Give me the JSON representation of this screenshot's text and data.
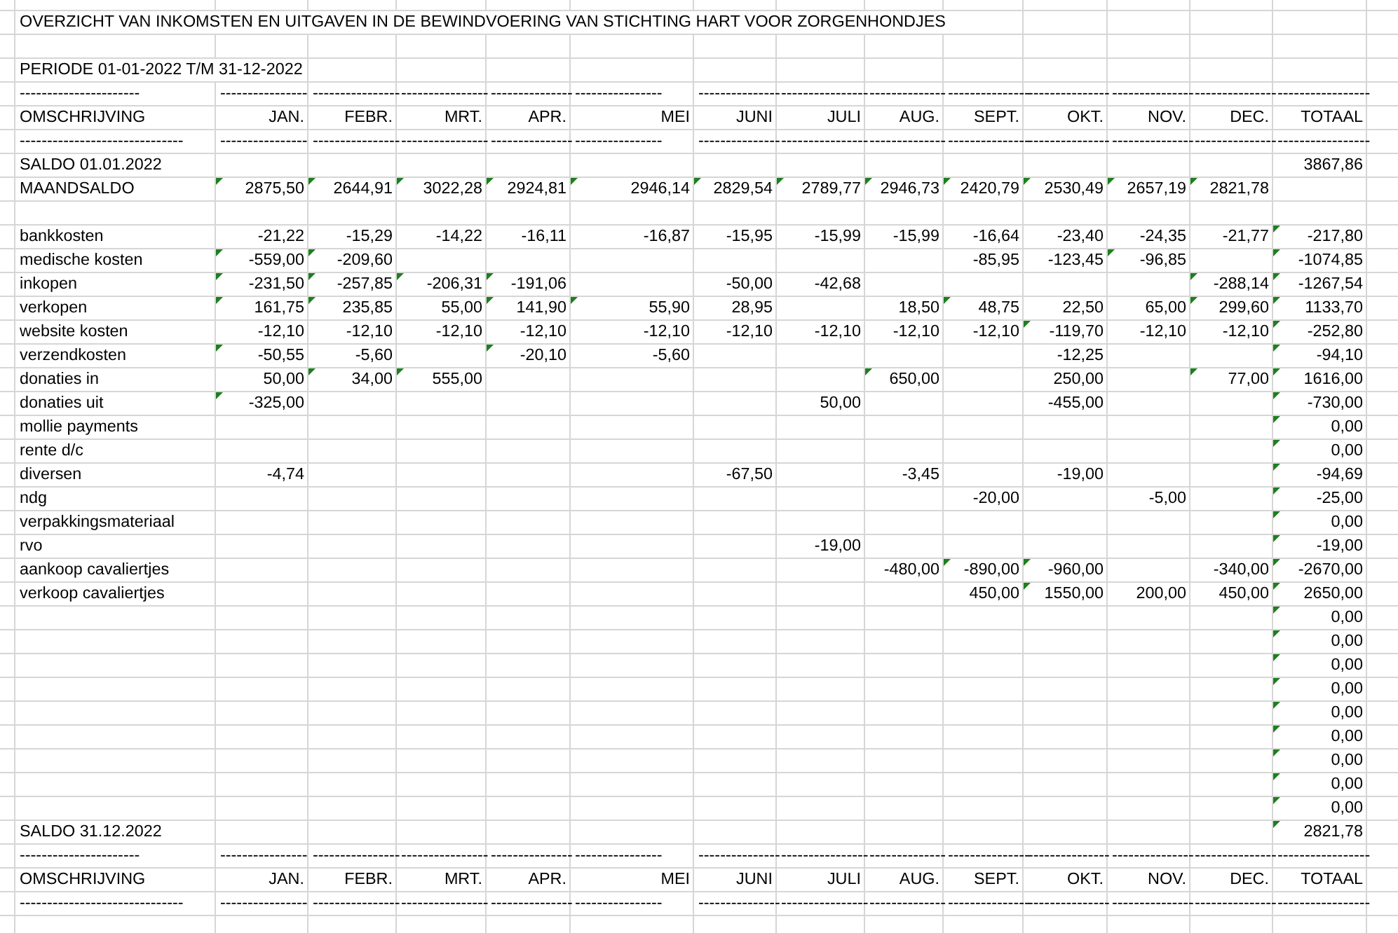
{
  "sheet": {
    "rows": [
      {
        "kind": "title",
        "label": "OVERZICHT VAN INKOMSTEN EN UITGAVEN IN DE BEWINDVOERING VAN STICHTING HART VOOR ZORGENHONDJES"
      },
      {
        "kind": "blank"
      },
      {
        "kind": "period",
        "label": "PERIODE 01-01-2022 T/M 31-12-2022"
      },
      {
        "kind": "rule",
        "label": "----------------------",
        "cells": [
          "----------------",
          "----------------",
          "----------------",
          "---------------",
          "----------------",
          "---------------",
          "----------------",
          "--------------",
          "---------------",
          "---------------",
          "---------------",
          "---------------",
          "-----------------"
        ]
      },
      {
        "kind": "header",
        "label": "OMSCHRIJVING",
        "cells": [
          "JAN.",
          "FEBR.",
          "MRT.",
          "APR.",
          "MEI",
          "JUNI",
          "JULI",
          "AUG.",
          "SEPT.",
          "OKT.",
          "NOV.",
          "DEC.",
          "TOTAAL"
        ]
      },
      {
        "kind": "rule",
        "label": "------------------------------",
        "cells": [
          "----------------",
          "----------------",
          "----------------",
          "---------------",
          "----------------",
          "---------------",
          "----------------",
          "--------------",
          "---------------",
          "---------------",
          "---------------",
          "---------------",
          "-----------------"
        ]
      },
      {
        "kind": "data",
        "label": "SALDO 01.01.2022",
        "cells": [
          null,
          null,
          null,
          null,
          null,
          null,
          null,
          null,
          null,
          null,
          null,
          null,
          {
            "value": "3867,86",
            "flagged": false
          }
        ]
      },
      {
        "kind": "data",
        "label": "MAANDSALDO",
        "cells": [
          {
            "value": "2875,50",
            "flagged": true
          },
          {
            "value": "2644,91",
            "flagged": true
          },
          {
            "value": "3022,28",
            "flagged": true
          },
          {
            "value": "2924,81",
            "flagged": true
          },
          {
            "value": "2946,14",
            "flagged": true
          },
          {
            "value": "2829,54",
            "flagged": true
          },
          {
            "value": "2789,77",
            "flagged": true
          },
          {
            "value": "2946,73",
            "flagged": true
          },
          {
            "value": "2420,79",
            "flagged": true
          },
          {
            "value": "2530,49",
            "flagged": true
          },
          {
            "value": "2657,19",
            "flagged": true
          },
          {
            "value": "2821,78",
            "flagged": true
          },
          null
        ]
      },
      {
        "kind": "blank"
      },
      {
        "kind": "data",
        "label": "bankkosten",
        "cells": [
          {
            "value": "-21,22",
            "flagged": false
          },
          {
            "value": "-15,29",
            "flagged": false
          },
          {
            "value": "-14,22",
            "flagged": false
          },
          {
            "value": "-16,11",
            "flagged": false
          },
          {
            "value": "-16,87",
            "flagged": false
          },
          {
            "value": "-15,95",
            "flagged": false
          },
          {
            "value": "-15,99",
            "flagged": false
          },
          {
            "value": "-15,99",
            "flagged": false
          },
          {
            "value": "-16,64",
            "flagged": false
          },
          {
            "value": "-23,40",
            "flagged": false
          },
          {
            "value": "-24,35",
            "flagged": false
          },
          {
            "value": "-21,77",
            "flagged": false
          },
          {
            "value": "-217,80",
            "flagged": true
          }
        ]
      },
      {
        "kind": "data",
        "label": "medische kosten",
        "cells": [
          {
            "value": "-559,00",
            "flagged": true
          },
          {
            "value": "-209,60",
            "flagged": true
          },
          null,
          null,
          null,
          null,
          null,
          null,
          {
            "value": "-85,95",
            "flagged": false
          },
          {
            "value": "-123,45",
            "flagged": false
          },
          {
            "value": "-96,85",
            "flagged": true
          },
          null,
          {
            "value": "-1074,85",
            "flagged": true
          }
        ]
      },
      {
        "kind": "data",
        "label": "inkopen",
        "cells": [
          {
            "value": "-231,50",
            "flagged": true
          },
          {
            "value": "-257,85",
            "flagged": true
          },
          {
            "value": "-206,31",
            "flagged": true
          },
          {
            "value": "-191,06",
            "flagged": true
          },
          null,
          {
            "value": "-50,00",
            "flagged": false
          },
          {
            "value": "-42,68",
            "flagged": false
          },
          null,
          null,
          null,
          null,
          {
            "value": "-288,14",
            "flagged": true
          },
          {
            "value": "-1267,54",
            "flagged": true
          }
        ]
      },
      {
        "kind": "data",
        "label": "verkopen",
        "cells": [
          {
            "value": "161,75",
            "flagged": true
          },
          {
            "value": "235,85",
            "flagged": true
          },
          {
            "value": "55,00",
            "flagged": false
          },
          {
            "value": "141,90",
            "flagged": true
          },
          {
            "value": "55,90",
            "flagged": true
          },
          {
            "value": "28,95",
            "flagged": false
          },
          null,
          {
            "value": "18,50",
            "flagged": false
          },
          {
            "value": "48,75",
            "flagged": true
          },
          {
            "value": "22,50",
            "flagged": false
          },
          {
            "value": "65,00",
            "flagged": false
          },
          {
            "value": "299,60",
            "flagged": true
          },
          {
            "value": "1133,70",
            "flagged": true
          }
        ]
      },
      {
        "kind": "data",
        "label": "website kosten",
        "cells": [
          {
            "value": "-12,10",
            "flagged": false
          },
          {
            "value": "-12,10",
            "flagged": false
          },
          {
            "value": "-12,10",
            "flagged": false
          },
          {
            "value": "-12,10",
            "flagged": false
          },
          {
            "value": "-12,10",
            "flagged": false
          },
          {
            "value": "-12,10",
            "flagged": false
          },
          {
            "value": "-12,10",
            "flagged": false
          },
          {
            "value": "-12,10",
            "flagged": false
          },
          {
            "value": "-12,10",
            "flagged": false
          },
          {
            "value": "-119,70",
            "flagged": true
          },
          {
            "value": "-12,10",
            "flagged": false
          },
          {
            "value": "-12,10",
            "flagged": false
          },
          {
            "value": "-252,80",
            "flagged": true
          }
        ]
      },
      {
        "kind": "data",
        "label": "verzendkosten",
        "cells": [
          {
            "value": "-50,55",
            "flagged": true
          },
          {
            "value": "-5,60",
            "flagged": false
          },
          null,
          {
            "value": "-20,10",
            "flagged": true
          },
          {
            "value": "-5,60",
            "flagged": false
          },
          null,
          null,
          null,
          null,
          {
            "value": "-12,25",
            "flagged": false
          },
          null,
          null,
          {
            "value": "-94,10",
            "flagged": true
          }
        ]
      },
      {
        "kind": "data",
        "label": "donaties in",
        "cells": [
          {
            "value": "50,00",
            "flagged": false
          },
          {
            "value": "34,00",
            "flagged": true
          },
          {
            "value": "555,00",
            "flagged": true
          },
          null,
          null,
          null,
          null,
          {
            "value": "650,00",
            "flagged": true
          },
          null,
          {
            "value": "250,00",
            "flagged": false
          },
          null,
          {
            "value": "77,00",
            "flagged": true
          },
          {
            "value": "1616,00",
            "flagged": true
          }
        ]
      },
      {
        "kind": "data",
        "label": "donaties uit",
        "cells": [
          {
            "value": "-325,00",
            "flagged": true
          },
          null,
          null,
          null,
          null,
          null,
          {
            "value": "50,00",
            "flagged": false
          },
          null,
          null,
          {
            "value": "-455,00",
            "flagged": false
          },
          null,
          null,
          {
            "value": "-730,00",
            "flagged": true
          }
        ]
      },
      {
        "kind": "data",
        "label": "mollie payments",
        "cells": [
          null,
          null,
          null,
          null,
          null,
          null,
          null,
          null,
          null,
          null,
          null,
          null,
          {
            "value": "0,00",
            "flagged": true
          }
        ]
      },
      {
        "kind": "data",
        "label": "rente d/c",
        "cells": [
          null,
          null,
          null,
          null,
          null,
          null,
          null,
          null,
          null,
          null,
          null,
          null,
          {
            "value": "0,00",
            "flagged": true
          }
        ]
      },
      {
        "kind": "data",
        "label": "diversen",
        "cells": [
          {
            "value": "-4,74",
            "flagged": false
          },
          null,
          null,
          null,
          null,
          {
            "value": "-67,50",
            "flagged": false
          },
          null,
          {
            "value": "-3,45",
            "flagged": false
          },
          null,
          {
            "value": "-19,00",
            "flagged": false
          },
          null,
          null,
          {
            "value": "-94,69",
            "flagged": true
          }
        ]
      },
      {
        "kind": "data",
        "label": "ndg",
        "cells": [
          null,
          null,
          null,
          null,
          null,
          null,
          null,
          null,
          {
            "value": "-20,00",
            "flagged": false
          },
          null,
          {
            "value": "-5,00",
            "flagged": false
          },
          null,
          {
            "value": "-25,00",
            "flagged": true
          }
        ]
      },
      {
        "kind": "data",
        "label": "verpakkingsmateriaal",
        "cells": [
          null,
          null,
          null,
          null,
          null,
          null,
          null,
          null,
          null,
          null,
          null,
          null,
          {
            "value": "0,00",
            "flagged": true
          }
        ]
      },
      {
        "kind": "data",
        "label": "rvo",
        "cells": [
          null,
          null,
          null,
          null,
          null,
          null,
          {
            "value": "-19,00",
            "flagged": false
          },
          null,
          null,
          null,
          null,
          null,
          {
            "value": "-19,00",
            "flagged": true
          }
        ]
      },
      {
        "kind": "data",
        "label": "aankoop cavaliertjes",
        "cells": [
          null,
          null,
          null,
          null,
          null,
          null,
          null,
          {
            "value": "-480,00",
            "flagged": false
          },
          {
            "value": "-890,00",
            "flagged": true
          },
          {
            "value": "-960,00",
            "flagged": true
          },
          null,
          {
            "value": "-340,00",
            "flagged": false
          },
          {
            "value": "-2670,00",
            "flagged": true
          }
        ]
      },
      {
        "kind": "data",
        "label": "verkoop cavaliertjes",
        "cells": [
          null,
          null,
          null,
          null,
          null,
          null,
          null,
          null,
          {
            "value": "450,00",
            "flagged": false
          },
          {
            "value": "1550,00",
            "flagged": true
          },
          {
            "value": "200,00",
            "flagged": false
          },
          {
            "value": "450,00",
            "flagged": false
          },
          {
            "value": "2650,00",
            "flagged": true
          }
        ]
      },
      {
        "kind": "data",
        "cells": [
          null,
          null,
          null,
          null,
          null,
          null,
          null,
          null,
          null,
          null,
          null,
          null,
          {
            "value": "0,00",
            "flagged": true
          }
        ]
      },
      {
        "kind": "data",
        "cells": [
          null,
          null,
          null,
          null,
          null,
          null,
          null,
          null,
          null,
          null,
          null,
          null,
          {
            "value": "0,00",
            "flagged": true
          }
        ]
      },
      {
        "kind": "data",
        "cells": [
          null,
          null,
          null,
          null,
          null,
          null,
          null,
          null,
          null,
          null,
          null,
          null,
          {
            "value": "0,00",
            "flagged": true
          }
        ]
      },
      {
        "kind": "data",
        "cells": [
          null,
          null,
          null,
          null,
          null,
          null,
          null,
          null,
          null,
          null,
          null,
          null,
          {
            "value": "0,00",
            "flagged": true
          }
        ]
      },
      {
        "kind": "data",
        "cells": [
          null,
          null,
          null,
          null,
          null,
          null,
          null,
          null,
          null,
          null,
          null,
          null,
          {
            "value": "0,00",
            "flagged": true
          }
        ]
      },
      {
        "kind": "data",
        "cells": [
          null,
          null,
          null,
          null,
          null,
          null,
          null,
          null,
          null,
          null,
          null,
          null,
          {
            "value": "0,00",
            "flagged": true
          }
        ]
      },
      {
        "kind": "data",
        "cells": [
          null,
          null,
          null,
          null,
          null,
          null,
          null,
          null,
          null,
          null,
          null,
          null,
          {
            "value": "0,00",
            "flagged": true
          }
        ]
      },
      {
        "kind": "data",
        "cells": [
          null,
          null,
          null,
          null,
          null,
          null,
          null,
          null,
          null,
          null,
          null,
          null,
          {
            "value": "0,00",
            "flagged": true
          }
        ]
      },
      {
        "kind": "data",
        "cells": [
          null,
          null,
          null,
          null,
          null,
          null,
          null,
          null,
          null,
          null,
          null,
          null,
          {
            "value": "0,00",
            "flagged": true
          }
        ]
      },
      {
        "kind": "data",
        "label": "SALDO 31.12.2022",
        "cells": [
          null,
          null,
          null,
          null,
          null,
          null,
          null,
          null,
          null,
          null,
          null,
          null,
          {
            "value": "2821,78",
            "flagged": true
          }
        ]
      },
      {
        "kind": "rule",
        "label": "----------------------",
        "cells": [
          "----------------",
          "----------------",
          "----------------",
          "---------------",
          "----------------",
          "---------------",
          "----------------",
          "--------------",
          "---------------",
          "---------------",
          "---------------",
          "---------------",
          "-----------------"
        ]
      },
      {
        "kind": "header",
        "label": "OMSCHRIJVING",
        "cells": [
          "JAN.",
          "FEBR.",
          "MRT.",
          "APR.",
          "MEI",
          "JUNI",
          "JULI",
          "AUG.",
          "SEPT.",
          "OKT.",
          "NOV.",
          "DEC.",
          "TOTAAL"
        ]
      },
      {
        "kind": "rule",
        "label": "------------------------------",
        "cells": [
          "----------------",
          "----------------",
          "----------------",
          "---------------",
          "----------------",
          "---------------",
          "----------------",
          "--------------",
          "---------------",
          "---------------",
          "---------------",
          "---------------",
          "-----------------"
        ]
      },
      {
        "kind": "blank"
      }
    ]
  }
}
